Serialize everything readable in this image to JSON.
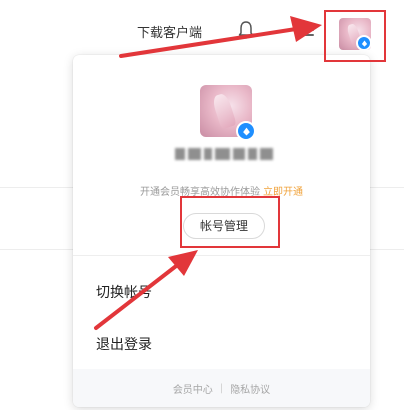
{
  "header": {
    "download_label": "下载客户端",
    "icons": [
      "bell-icon",
      "menu-icon"
    ]
  },
  "account_panel": {
    "promo_text": "开通会员畅享高效协作体验",
    "promo_link": "立即开通",
    "manage_button": "帐号管理",
    "menu": {
      "switch_account": "切换帐号",
      "logout": "退出登录"
    },
    "footer": {
      "member_center": "会员中心",
      "separator": "|",
      "privacy": "隐私协议"
    }
  },
  "colors": {
    "highlight": "#e2363a",
    "promo_link": "#f0a33c",
    "badge": "#1f8fff",
    "footer_bg": "#f7f8fa"
  }
}
